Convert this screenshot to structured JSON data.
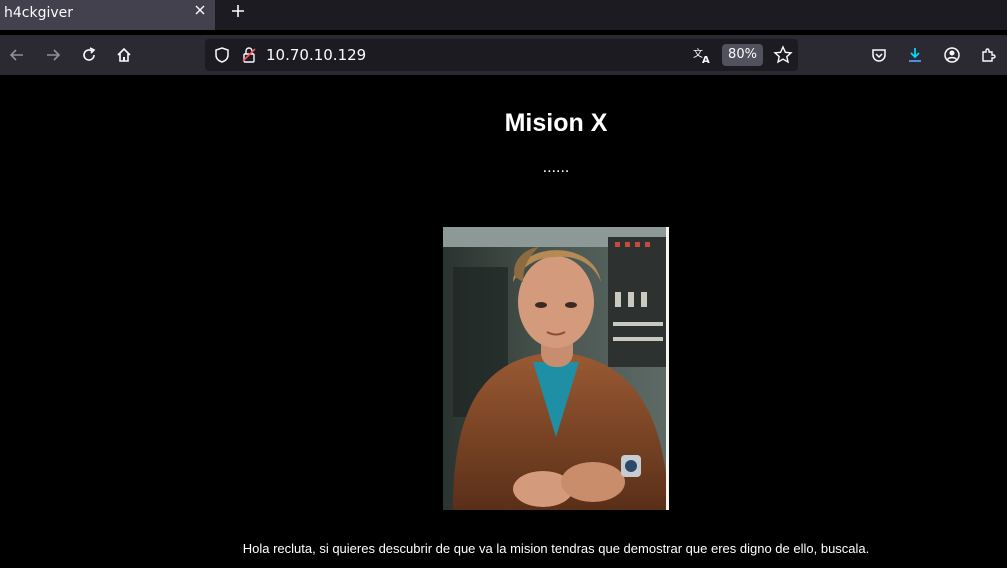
{
  "browser": {
    "tab": {
      "title": "h4ckgiver"
    },
    "url": "10.70.10.129",
    "zoom": "80%",
    "icons": [
      "back-icon",
      "forward-icon",
      "reload-icon",
      "home-icon",
      "shield-icon",
      "insecure-lock-icon",
      "translate-icon",
      "bookmark-star-icon",
      "pocket-icon",
      "downloads-icon",
      "account-icon",
      "extensions-icon"
    ]
  },
  "page": {
    "title": "Mision X",
    "dots": "......",
    "caption": "Hola recluta, si quieres descubrir de que va la mision tendras que demostrar que eres digno de ello, buscala."
  }
}
